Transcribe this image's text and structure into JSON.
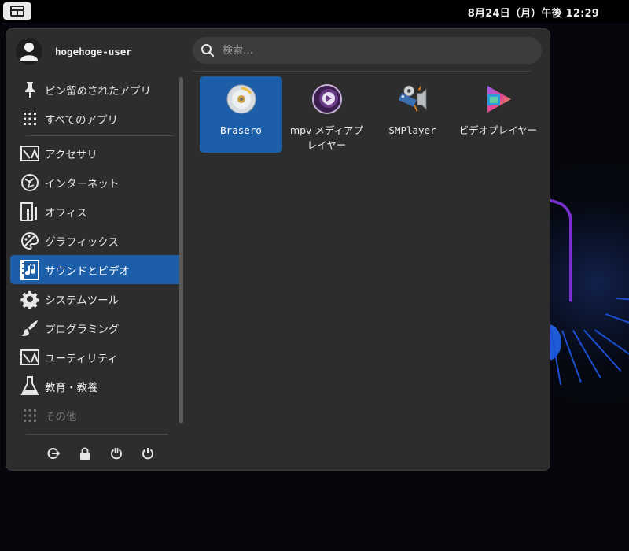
{
  "topbar": {
    "clock": "8月24日（月）午後 12:29"
  },
  "user": {
    "name": "hogehoge-user"
  },
  "search": {
    "placeholder": "検索…"
  },
  "sidebar": {
    "items": [
      {
        "label": "ピン留めされたアプリ",
        "icon": "pin-icon"
      },
      {
        "label": "すべてのアプリ",
        "icon": "grid-icon"
      },
      {
        "label": "アクセサリ",
        "icon": "accessories-icon"
      },
      {
        "label": "インターネット",
        "icon": "internet-icon"
      },
      {
        "label": "オフィス",
        "icon": "office-icon"
      },
      {
        "label": "グラフィックス",
        "icon": "graphics-icon"
      },
      {
        "label": "サウンドとビデオ",
        "icon": "sound-video-icon",
        "active": true
      },
      {
        "label": "システムツール",
        "icon": "gear-icon"
      },
      {
        "label": "プログラミング",
        "icon": "programming-icon"
      },
      {
        "label": "ユーティリティ",
        "icon": "utilities-icon"
      },
      {
        "label": "教育・教養",
        "icon": "flask-icon"
      },
      {
        "label": "その他",
        "icon": "grid-icon"
      }
    ]
  },
  "actions": [
    "logout-icon",
    "lock-icon",
    "suspend-icon",
    "power-icon"
  ],
  "apps": [
    {
      "label": "Brasero",
      "icon": "brasero-icon",
      "selected": true
    },
    {
      "label": "mpv メディアプレイヤー",
      "icon": "mpv-icon"
    },
    {
      "label": "SMPlayer",
      "icon": "smplayer-icon"
    },
    {
      "label": "ビデオプレイヤー",
      "icon": "video-player-icon"
    }
  ],
  "colors": {
    "accent": "#1d5ea8",
    "panel": "#2d2d2d",
    "topbar": "#000000"
  }
}
